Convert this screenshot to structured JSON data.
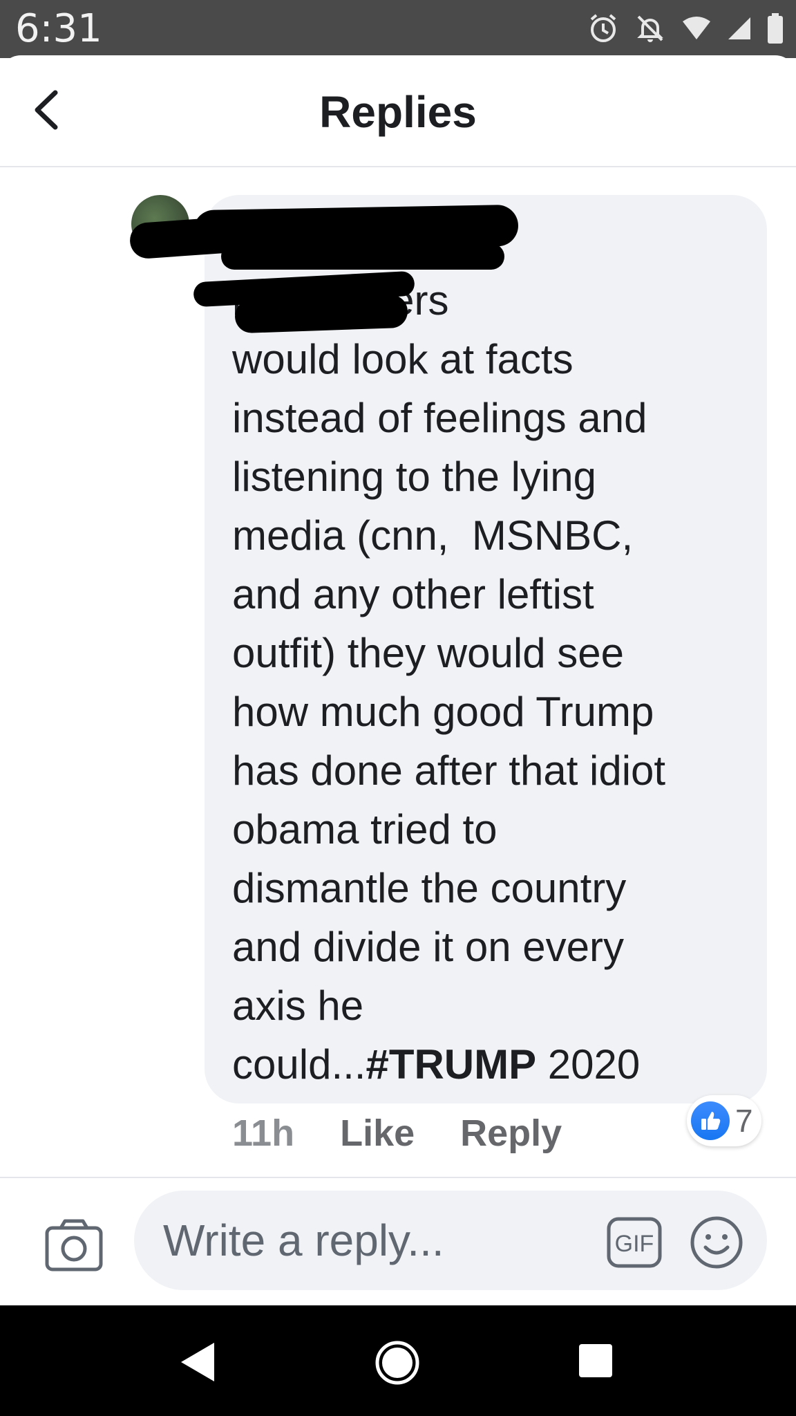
{
  "status_bar": {
    "time": "6:31",
    "icons": [
      "alarm-icon",
      "notifications-off-icon",
      "wifi-icon",
      "signal-icon",
      "battery-icon"
    ]
  },
  "header": {
    "title": "Replies",
    "back_icon": "chevron-left-icon"
  },
  "comment": {
    "author_redacted": true,
    "text": "if the haters\nwould look at facts\ninstead of feelings and\nlistening to the lying\nmedia (cnn,  MSNBC,\nand any other leftist\noutfit) they would see\nhow much good Trump\nhas done after that idiot\nobama tried to\ndismantle the country\nand divide it on every\naxis he\ncould...",
    "hashtag": "#TRUMP",
    "year": " 2020",
    "time_ago": "11h",
    "like_label": "Like",
    "reply_label": "Reply",
    "reaction_count": "7",
    "reaction_icon": "thumbs-up-icon"
  },
  "composer": {
    "placeholder": "Write a reply...",
    "gif_label": "GIF",
    "camera_icon": "camera-icon",
    "emoji_icon": "smiley-icon"
  },
  "nav_bar": {
    "icons": [
      "back-triangle-icon",
      "home-circle-icon",
      "recents-square-icon"
    ]
  },
  "colors": {
    "bubble": "#f0f2f5",
    "status_bar": "#4a4a4a",
    "like_blue": "#1877f2",
    "secondary_text": "#65676b"
  }
}
